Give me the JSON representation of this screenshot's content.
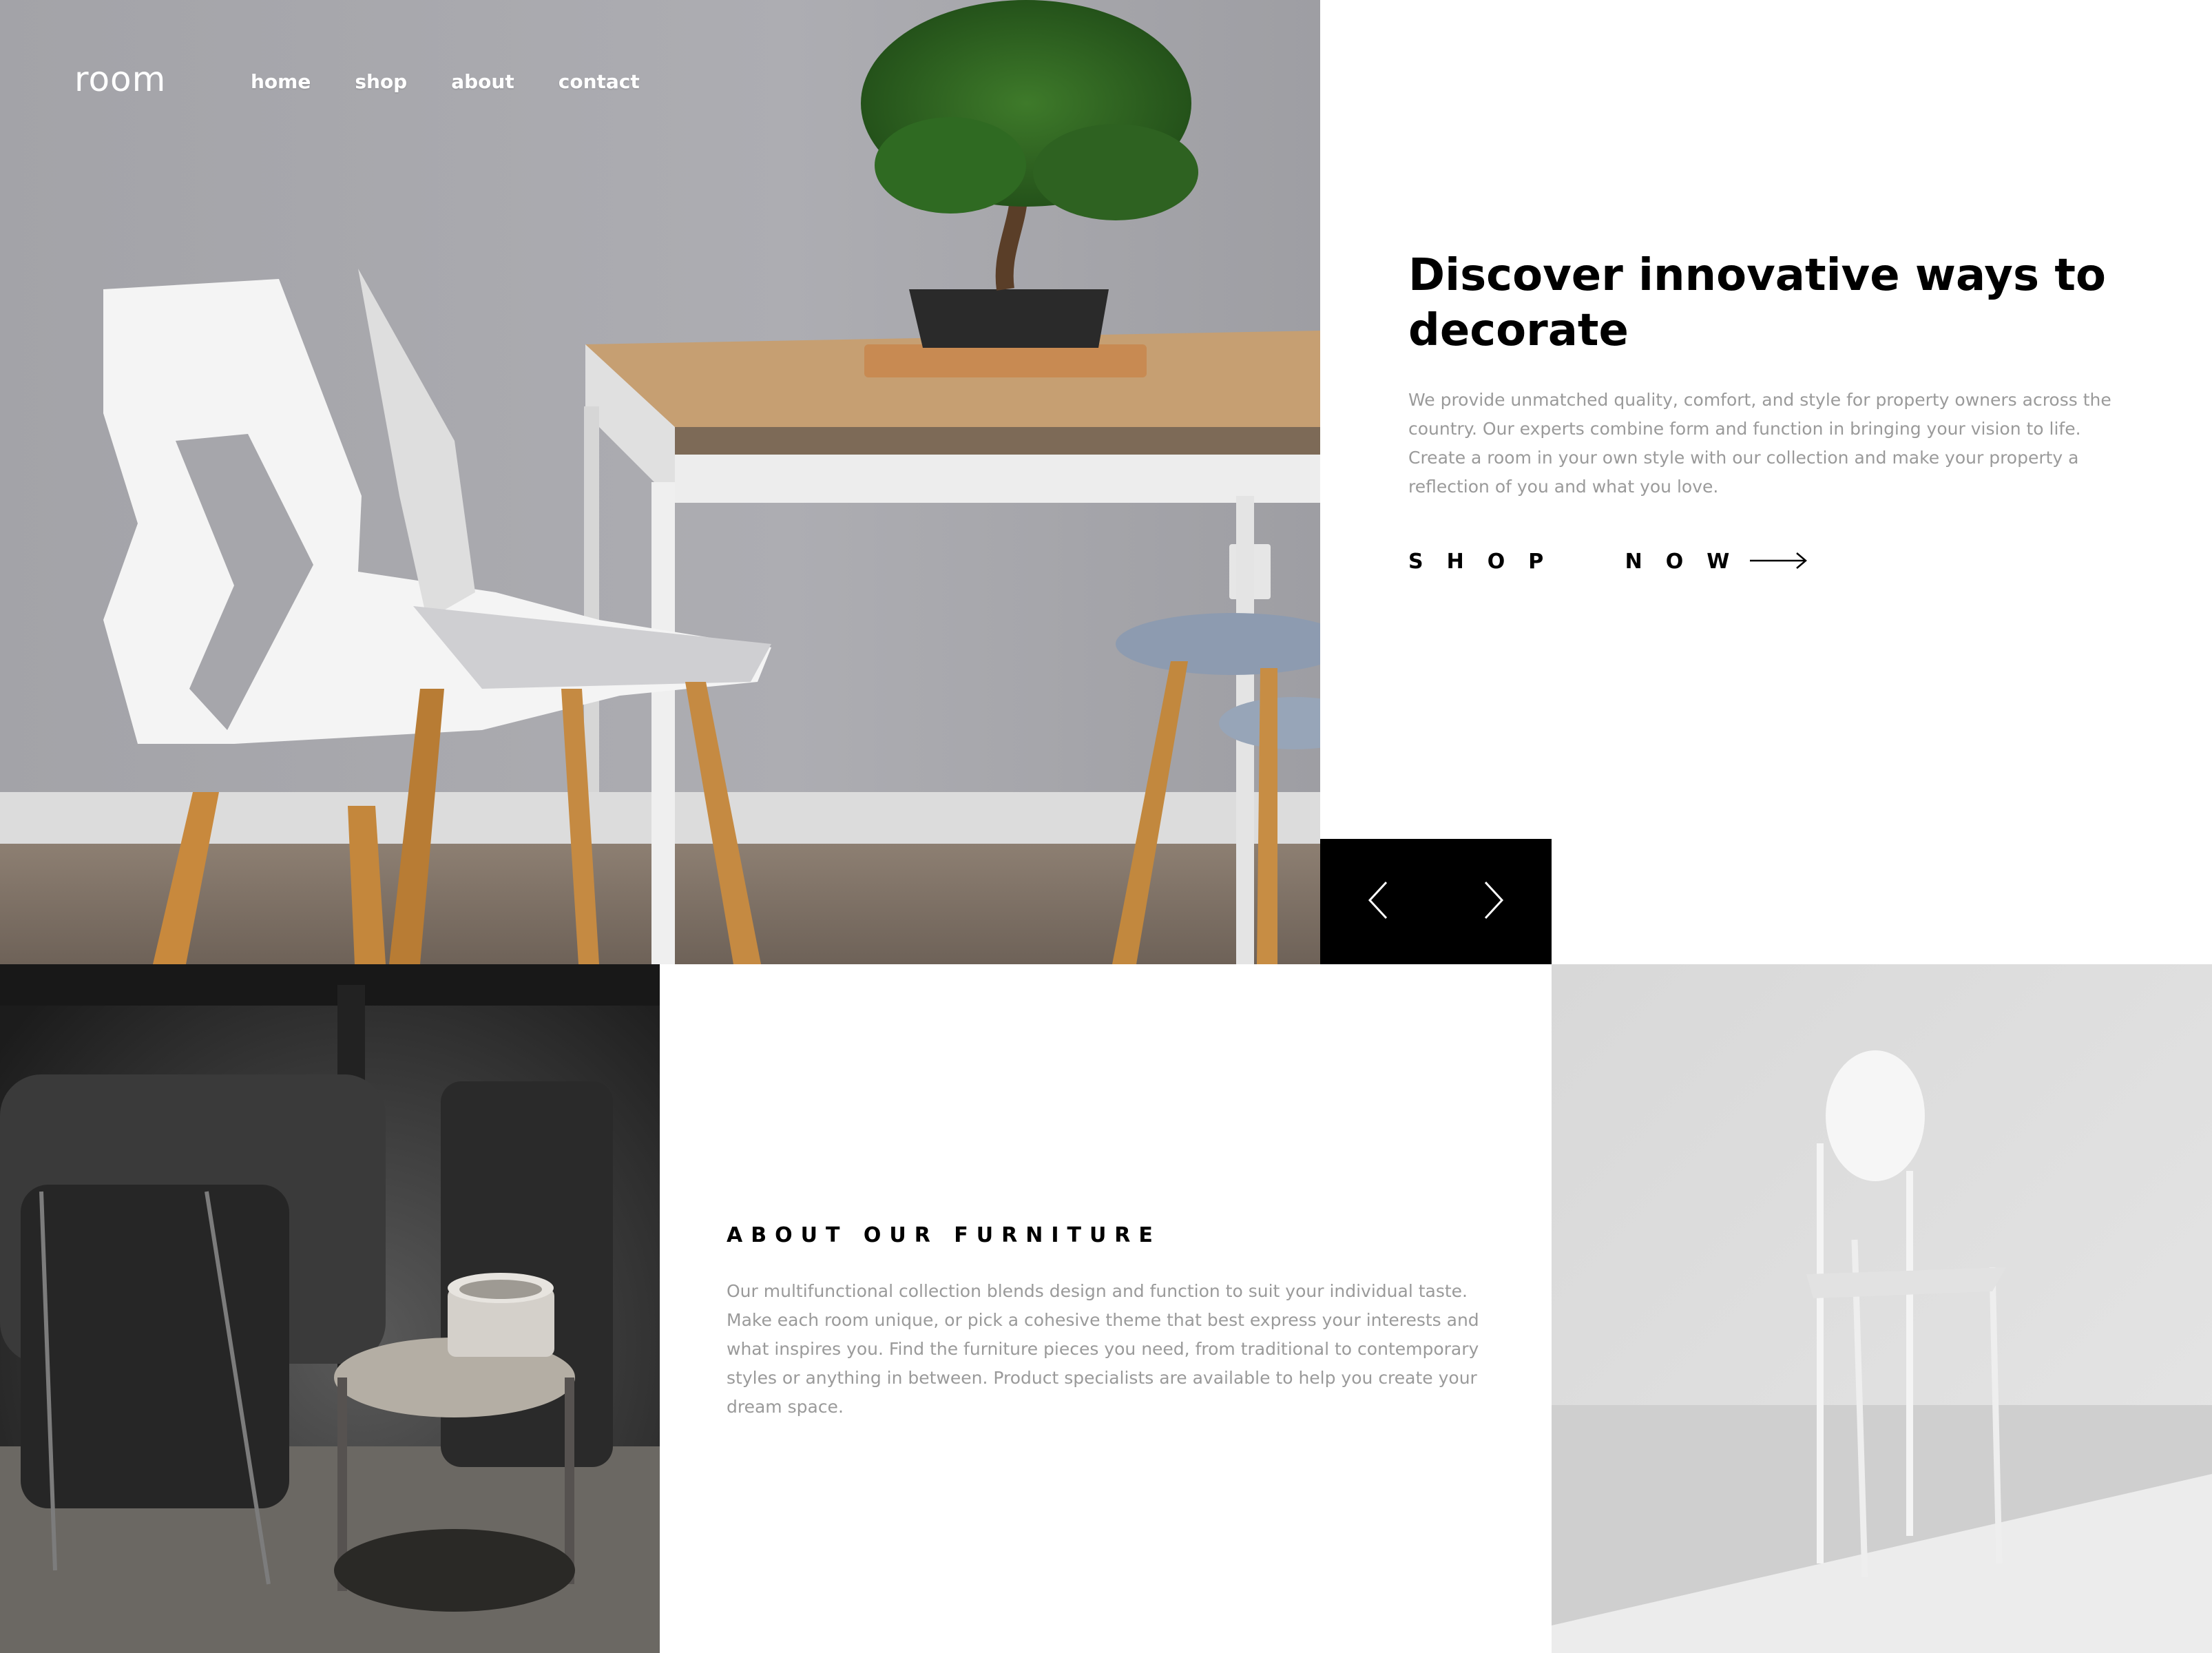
{
  "brand": {
    "logo_text": "room"
  },
  "nav": {
    "items": [
      {
        "label": "home"
      },
      {
        "label": "shop"
      },
      {
        "label": "about"
      },
      {
        "label": "contact"
      }
    ]
  },
  "hero": {
    "title": "Discover innovative ways to decorate",
    "description": "We provide unmatched quality, comfort, and style for property owners across the country. Our experts combine form and function in bringing your vision to life. Create a room in your own style with our collection and make your property a reflection of you and what you love.",
    "cta_label": "SHOP NOW",
    "cta_icon": "arrow-right-icon"
  },
  "slider": {
    "prev_icon": "chevron-left-icon",
    "next_icon": "chevron-right-icon"
  },
  "about": {
    "title": "ABOUT OUR FURNITURE",
    "description": "Our multifunctional collection blends design and function to suit your individual taste. Make each room unique, or pick a cohesive theme that best express your interests and what inspires you. Find the furniture pieces you need, from traditional to contemporary styles or anything in between. Product specialists are available to help you create your dream space."
  },
  "colors": {
    "text_primary": "#000000",
    "text_muted": "#9a9a9a",
    "slider_bg": "#000000",
    "background": "#ffffff"
  }
}
